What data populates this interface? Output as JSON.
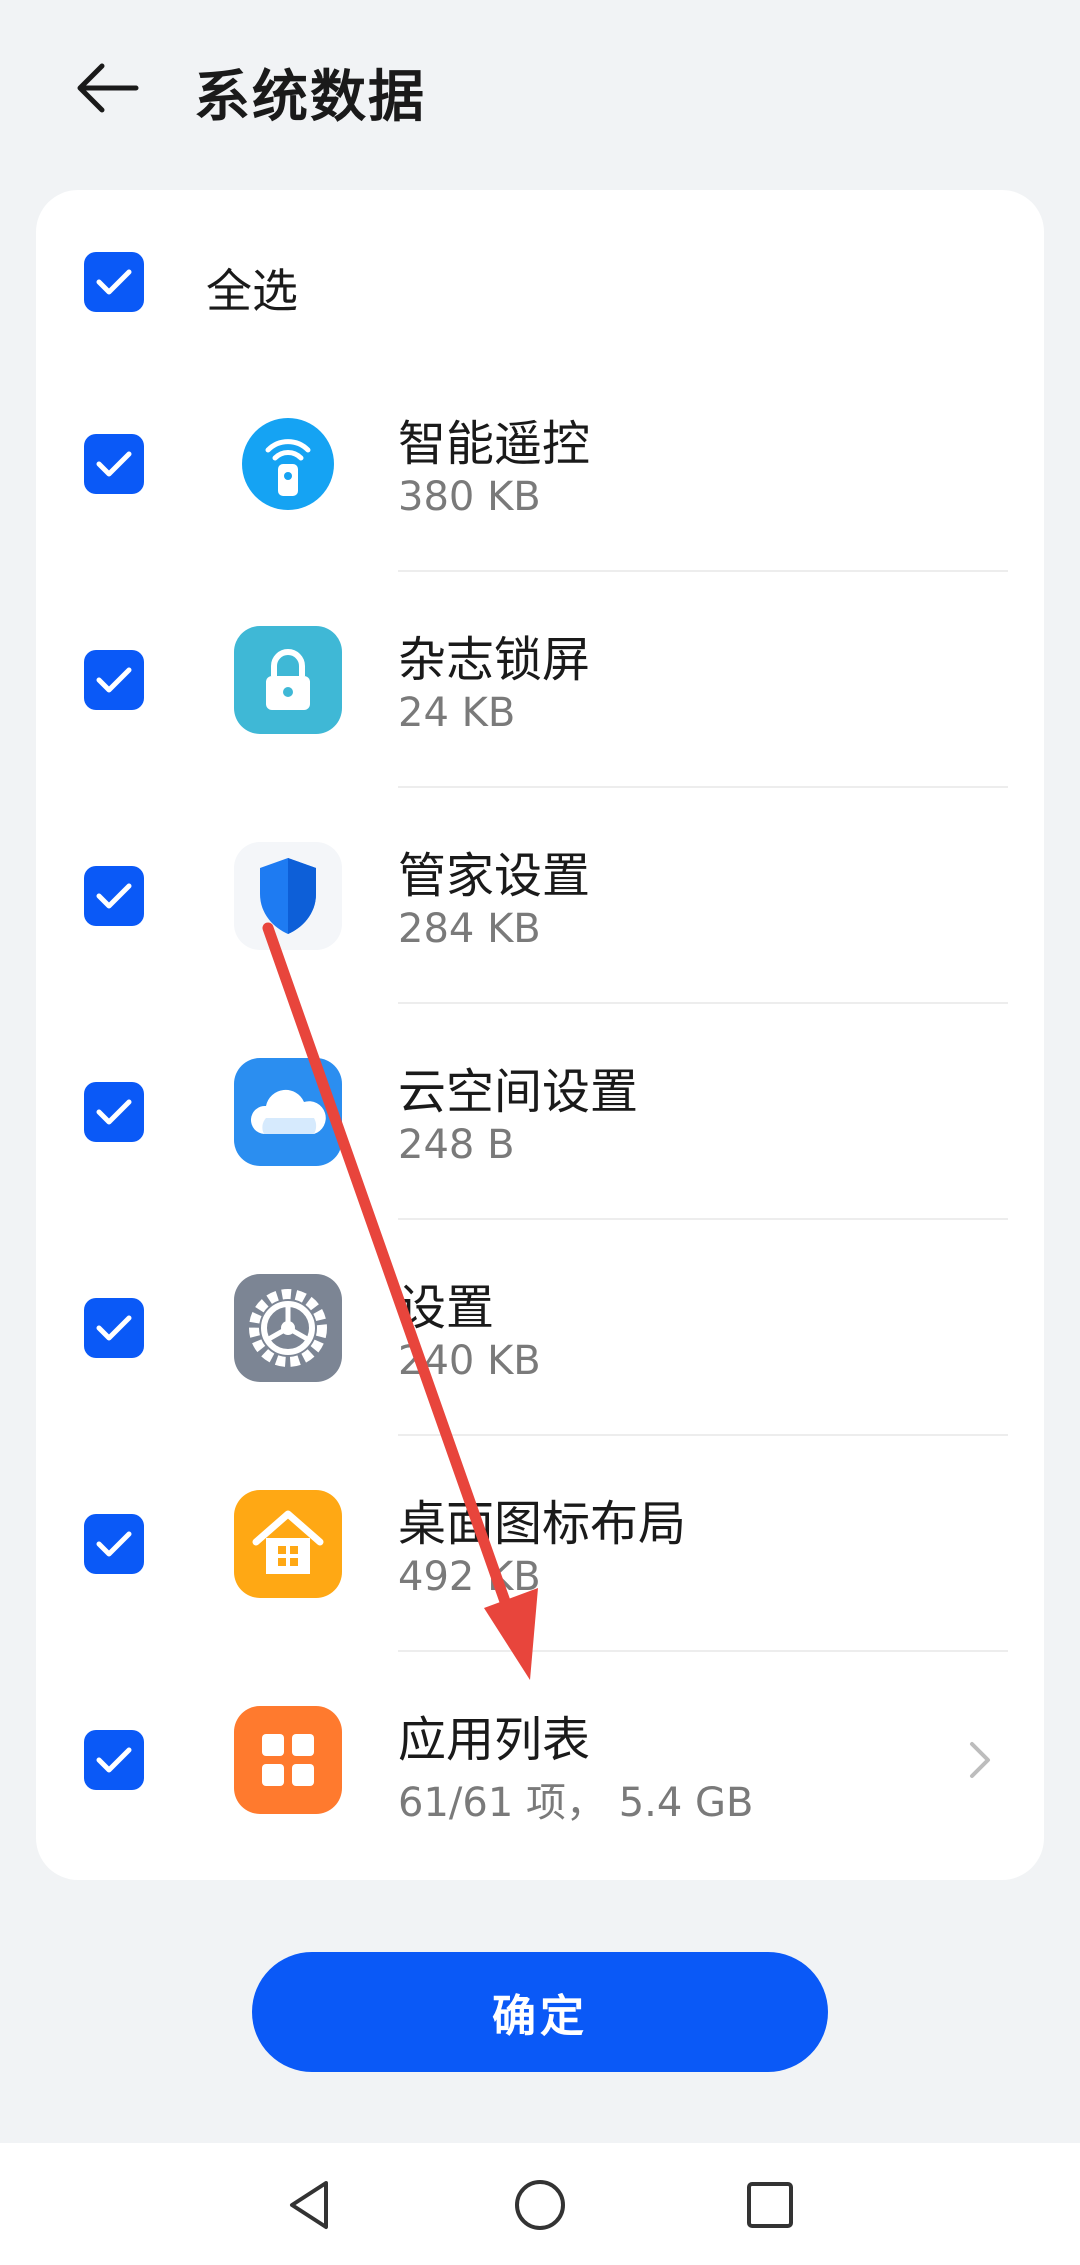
{
  "header": {
    "title": "系统数据",
    "back_icon": "arrow-left-icon"
  },
  "select_all": {
    "label": "全选",
    "checked": true
  },
  "items": [
    {
      "name": "智能遥控",
      "size": "380 KB",
      "icon": "remote-control-icon",
      "checked": true
    },
    {
      "name": "杂志锁屏",
      "size": "24 KB",
      "icon": "lock-icon",
      "checked": true
    },
    {
      "name": "管家设置",
      "size": "284 KB",
      "icon": "shield-icon",
      "checked": true
    },
    {
      "name": "云空间设置",
      "size": "248 B",
      "icon": "cloud-icon",
      "checked": true
    },
    {
      "name": "设置",
      "size": "240 KB",
      "icon": "gear-icon",
      "checked": true
    },
    {
      "name": "桌面图标布局",
      "size": "492 KB",
      "icon": "home-icon",
      "checked": true
    },
    {
      "name": "应用列表",
      "size": "61/61 项， 5.4 GB",
      "icon": "app-grid-icon",
      "checked": true,
      "has_chevron": true
    }
  ],
  "confirm": {
    "label": "确定"
  },
  "nav": {
    "back": "nav-back-icon",
    "home": "nav-home-icon",
    "recents": "nav-recents-icon"
  },
  "colors": {
    "accent": "#0A59F7",
    "background": "#F1F3F5",
    "annotation_arrow": "#E8453C"
  }
}
